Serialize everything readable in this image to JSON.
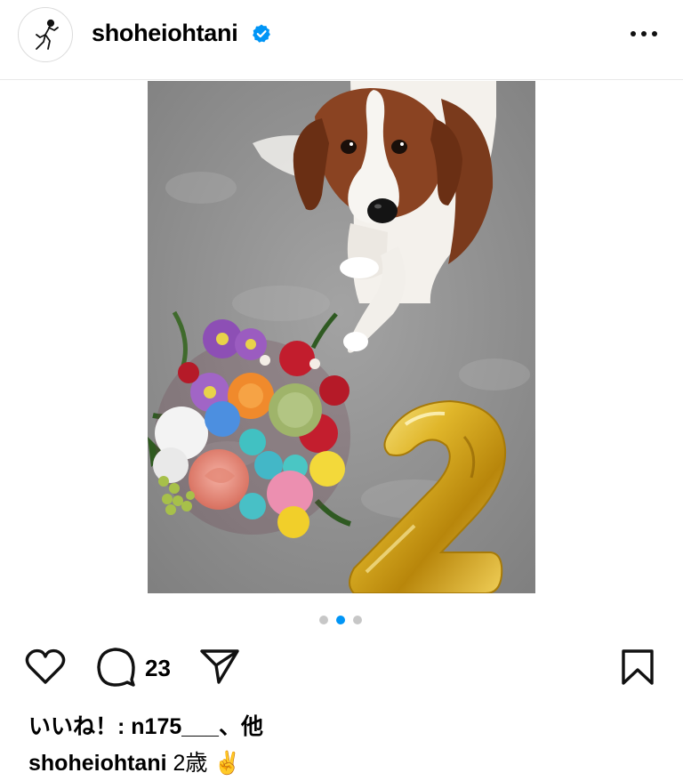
{
  "post_header": {
    "username": "shoheiohtani",
    "verified": true,
    "avatar_icon": "baseball-pitcher-silhouette-icon",
    "more_icon": "ellipsis-icon"
  },
  "post_media": {
    "carousel_total": 3,
    "carousel_active_index": 1,
    "subject": "dog with flowers and gold number 2 balloon"
  },
  "actions": {
    "like_icon": "heart-outline-icon",
    "comment_icon": "comment-bubble-icon",
    "comment_count": "23",
    "share_icon": "paper-plane-icon",
    "save_icon": "bookmark-outline-icon"
  },
  "likes": {
    "text": "いいね！: n175___、他"
  },
  "caption": {
    "username": "shoheiohtani",
    "text": " 2歳 ✌️"
  },
  "colors": {
    "accent": "#0095f6",
    "inactive_dot": "#c7c7c7",
    "text": "#000000",
    "divider": "#e8e8e8"
  }
}
